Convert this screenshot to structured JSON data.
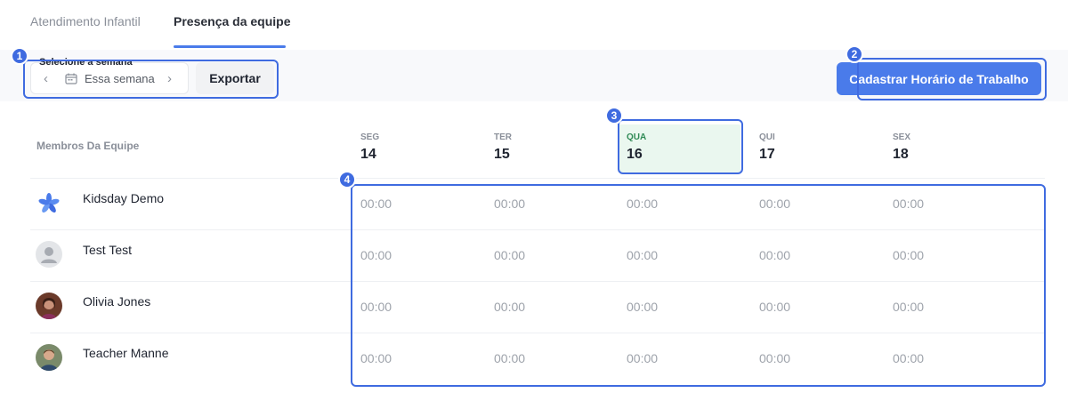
{
  "tabs": [
    {
      "label": "Atendimento Infantil",
      "active": false
    },
    {
      "label": "Presença da equipe",
      "active": true
    }
  ],
  "toolbar": {
    "week_label": "Selecione a semana",
    "week_value": "Essa semana",
    "export_label": "Exportar",
    "primary_label": "Cadastrar Horário de Trabalho"
  },
  "table": {
    "members_header": "Membros Da Equipe",
    "days": [
      {
        "name": "SEG",
        "num": "14",
        "today": false
      },
      {
        "name": "TER",
        "num": "15",
        "today": false
      },
      {
        "name": "QUA",
        "num": "16",
        "today": true
      },
      {
        "name": "QUI",
        "num": "17",
        "today": false
      },
      {
        "name": "SEX",
        "num": "18",
        "today": false
      }
    ],
    "members": [
      {
        "name": "Kidsday Demo",
        "avatar": "kidsday-logo-avatar",
        "times": [
          "00:00",
          "00:00",
          "00:00",
          "00:00",
          "00:00"
        ]
      },
      {
        "name": "Test Test",
        "avatar": "default-user-avatar",
        "times": [
          "00:00",
          "00:00",
          "00:00",
          "00:00",
          "00:00"
        ]
      },
      {
        "name": "Olivia Jones",
        "avatar": "photo-avatar",
        "times": [
          "00:00",
          "00:00",
          "00:00",
          "00:00",
          "00:00"
        ]
      },
      {
        "name": "Teacher Manne",
        "avatar": "photo-avatar",
        "times": [
          "00:00",
          "00:00",
          "00:00",
          "00:00",
          "00:00"
        ]
      }
    ]
  },
  "annotations": [
    "1",
    "2",
    "3",
    "4"
  ],
  "colors": {
    "accent": "#4a7bea",
    "annotation": "#3f6be0",
    "today_bg": "#eaf7ef",
    "today_text": "#2f8a55"
  }
}
